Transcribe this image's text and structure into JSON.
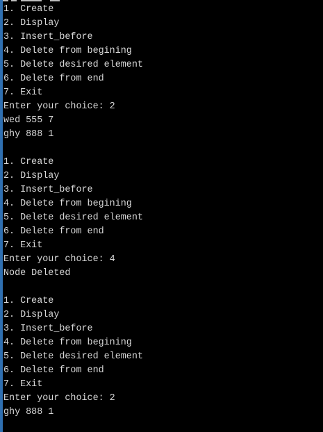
{
  "console": {
    "lines": [
      "1. Create",
      "2. Display",
      "3. Insert_before",
      "4. Delete from begining",
      "5. Delete desired element",
      "6. Delete from end",
      "7. Exit",
      "Enter your choice: 2",
      "wed 555 7",
      "ghy 888 1",
      "",
      "1. Create",
      "2. Display",
      "3. Insert_before",
      "4. Delete from begining",
      "5. Delete desired element",
      "6. Delete from end",
      "7. Exit",
      "Enter your choice: 4",
      "Node Deleted",
      "",
      "1. Create",
      "2. Display",
      "3. Insert_before",
      "4. Delete from begining",
      "5. Delete desired element",
      "6. Delete from end",
      "7. Exit",
      "Enter your choice: 2",
      "ghy 888 1"
    ]
  },
  "colors": {
    "background": "#000000",
    "text": "#d8d8d8",
    "frame_edge": "#2f6fb0"
  }
}
